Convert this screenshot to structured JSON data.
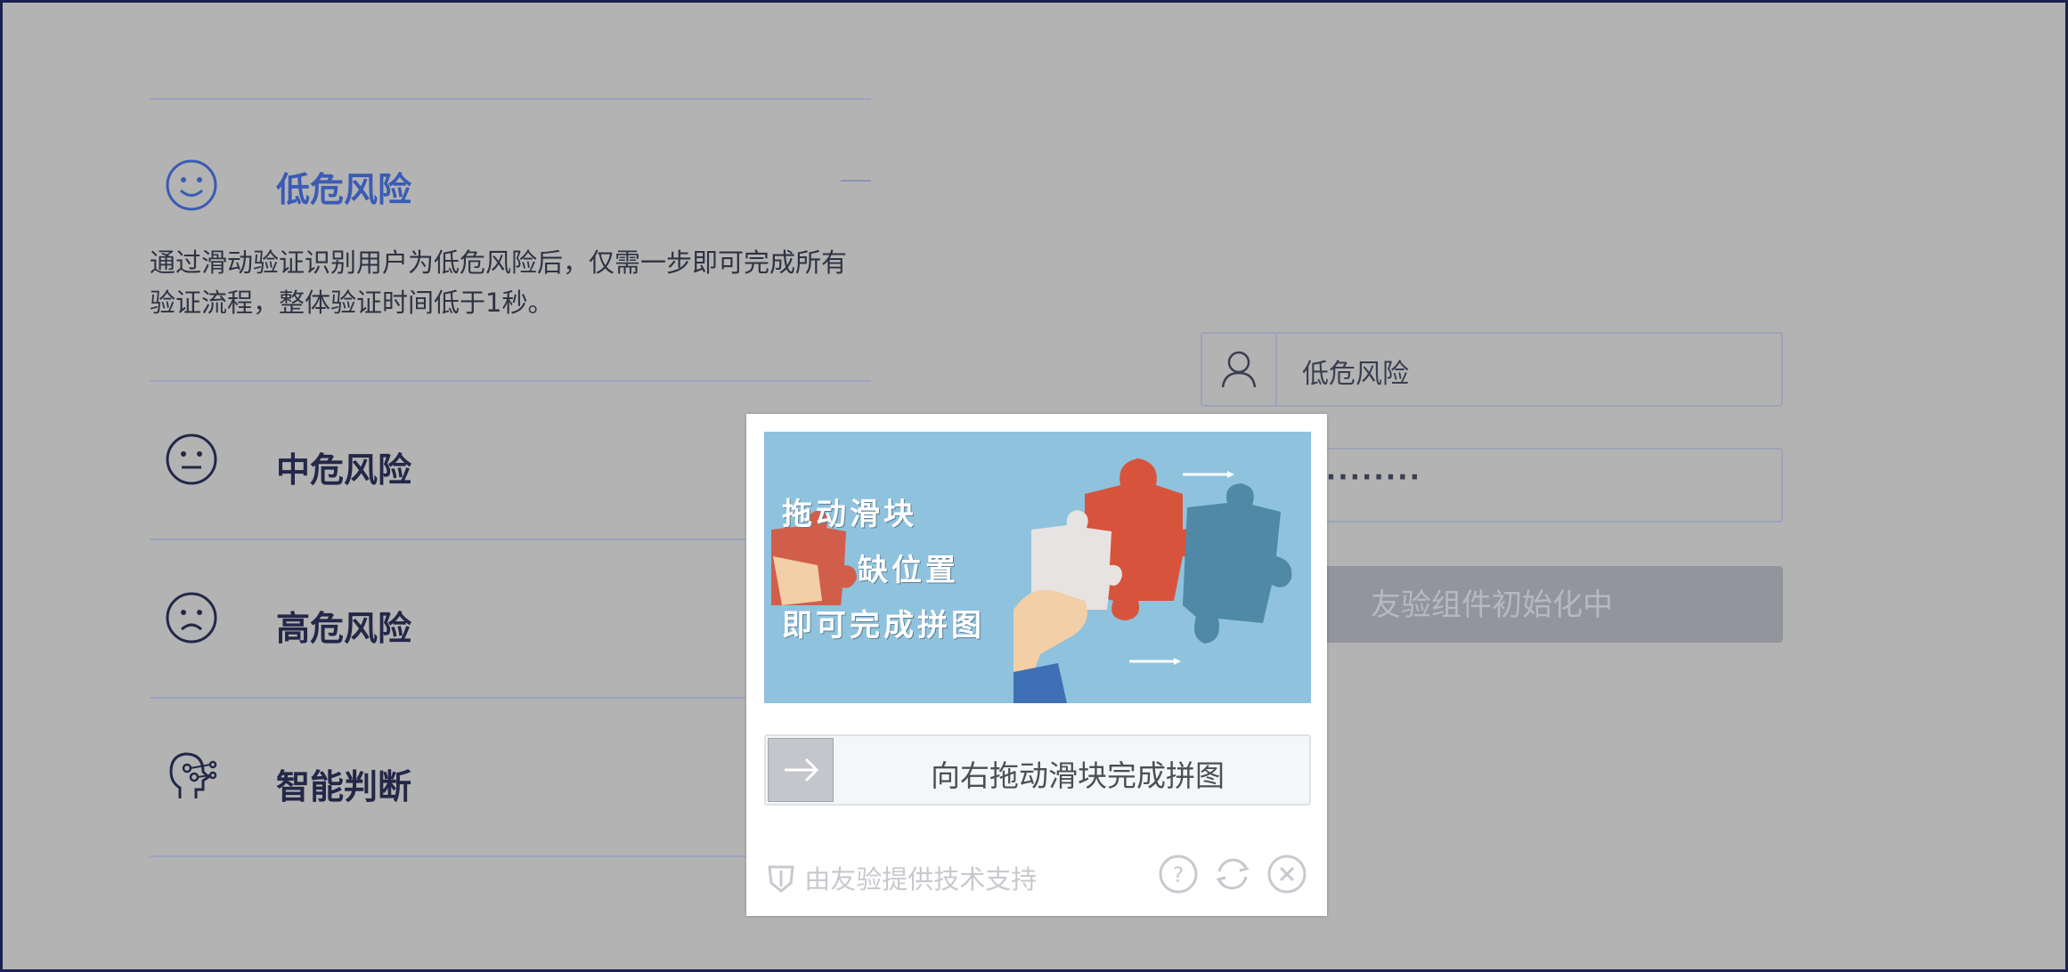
{
  "accordion": {
    "items": [
      {
        "label": "低危风险",
        "icon": "smile-icon",
        "expanded": true,
        "description": "通过滑动验证识别用户为低危风险后，仅需一步即可完成所有验证流程，整体验证时间低于1秒。"
      },
      {
        "label": "中危风险",
        "icon": "neutral-face-icon"
      },
      {
        "label": "高危风险",
        "icon": "sad-face-icon"
      },
      {
        "label": "智能判断",
        "icon": "ai-head-icon"
      }
    ]
  },
  "form": {
    "username_value": "低危风险",
    "password_masked": "··········",
    "submit_label": "友验组件初始化中"
  },
  "captcha": {
    "image_text": [
      "拖动滑块",
      "缺位置",
      "即可完成拼图"
    ],
    "slider_hint": "向右拖动滑块完成拼图",
    "brand": "由友验提供技术支持"
  },
  "colors": {
    "overlay": "#b3b3b3",
    "accent": "#3b5bb4",
    "dark_text": "#232848"
  }
}
